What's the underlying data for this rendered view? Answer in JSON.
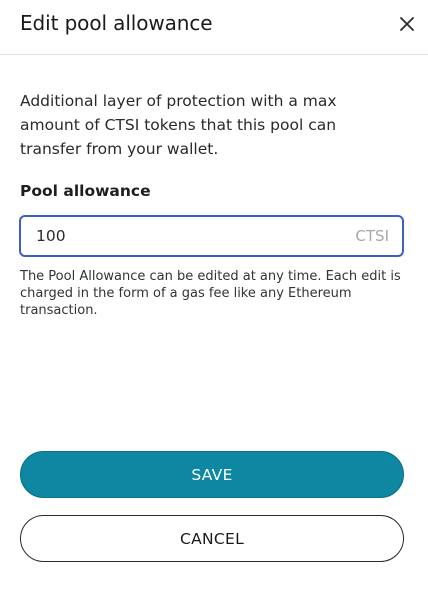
{
  "dialog": {
    "title": "Edit pool allowance",
    "close_icon": "close-icon",
    "description": "Additional layer of protection with a max amount of CTSI tokens that this pool can transfer from your wallet.",
    "field": {
      "label": "Pool allowance",
      "value": "100",
      "unit": "CTSI"
    },
    "help_text": "The Pool Allowance can be edited at any time. Each edit is charged in the form of a gas fee like any Ethereum transaction.",
    "save_label": "SAVE",
    "cancel_label": "CANCEL"
  },
  "colors": {
    "accent": "#0e87a2",
    "input_border": "#3d5fc4",
    "unit_text": "#a7a7a7"
  }
}
